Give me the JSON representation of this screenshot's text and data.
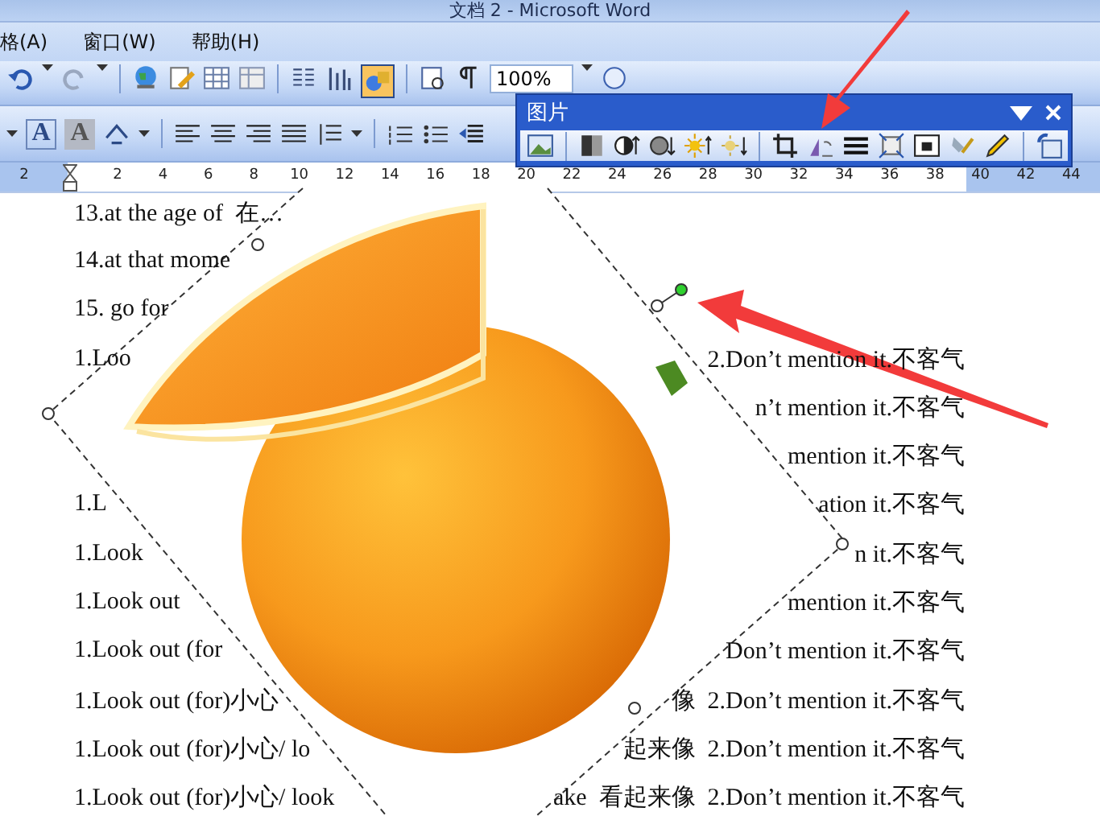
{
  "window": {
    "title": "文档 2 - Microsoft Word"
  },
  "menu": [
    {
      "label": "格(A)"
    },
    {
      "label": "窗口(W)"
    },
    {
      "label": "帮助(H)"
    }
  ],
  "standard_toolbar": {
    "zoom": "100%"
  },
  "formatting_toolbar": {
    "glyph_buttons": [
      {
        "label": "A",
        "kind": "boxed"
      },
      {
        "label": "A",
        "kind": "shaded"
      }
    ]
  },
  "ruler": {
    "numbers": [
      "2",
      "2",
      "4",
      "6",
      "8",
      "10",
      "12",
      "14",
      "16",
      "18",
      "20",
      "22",
      "24",
      "26",
      "28",
      "30",
      "32",
      "34",
      "36",
      "38",
      "40",
      "42",
      "44"
    ]
  },
  "picture_toolbar": {
    "title": "图片"
  },
  "document": {
    "rows": [
      {
        "left": "13.at the age of  在…"
      },
      {
        "left": "14.at that mome"
      },
      {
        "left": "15. go for"
      },
      {
        "left": "1.Loo",
        "right": "2.Don’t mention it.不客气"
      },
      {
        "right": "n’t mention it.不客气"
      },
      {
        "right": "mention it.不客气"
      },
      {
        "left": "1.L",
        "right": "ation it.不客气"
      },
      {
        "left": "1.Look",
        "right": "n it.不客气"
      },
      {
        "left": "1.Look out",
        "right": "mention it.不客气"
      },
      {
        "left": "1.Look out (for",
        "right": "Don’t mention it.不客气"
      },
      {
        "left": "1.Look out (for)小心",
        "right": "像  2.Don’t mention it.不客气"
      },
      {
        "left": "1.Look out (for)小心/ lo",
        "right": "起来像  2.Don’t mention it.不客气"
      },
      {
        "left": "1.Look out (for)小心/ look",
        "right": "ake  看起来像  2.Don’t mention it.不客气"
      }
    ]
  }
}
